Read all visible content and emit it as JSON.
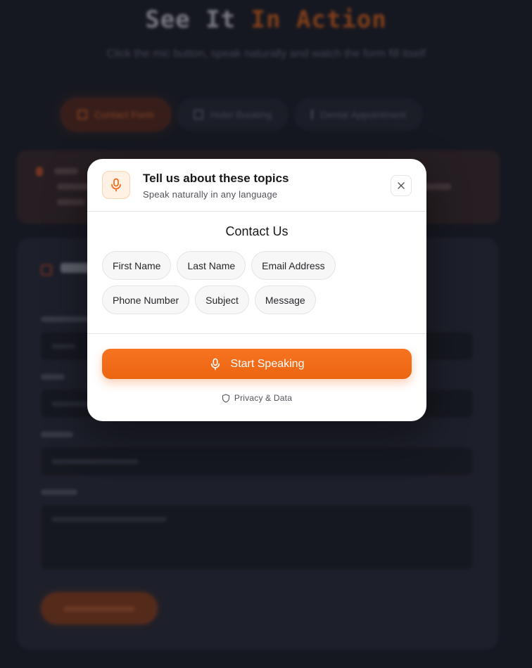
{
  "background": {
    "hero_title_main": "See It",
    "hero_title_accent": "In Action",
    "hero_subtitle": "Click the mic button, speak naturally and watch the form fill itself",
    "tabs": [
      {
        "label": "Contact Form",
        "active": true
      },
      {
        "label": "Hotel Booking",
        "active": false
      },
      {
        "label": "Dental Appointment",
        "active": false
      }
    ]
  },
  "modal": {
    "title": "Tell us about these topics",
    "subtitle": "Speak naturally in any language",
    "section_title": "Contact Us",
    "topics": [
      "First Name",
      "Last Name",
      "Email Address",
      "Phone Number",
      "Subject",
      "Message"
    ],
    "start_button_label": "Start Speaking",
    "privacy_label": "Privacy & Data"
  },
  "colors": {
    "accent": "#ef6a17",
    "modal_bg": "#ffffff",
    "page_bg": "#1e1f2a"
  },
  "icons": {
    "mic": "microphone-icon",
    "close": "close-icon",
    "privacy": "shield-icon"
  }
}
